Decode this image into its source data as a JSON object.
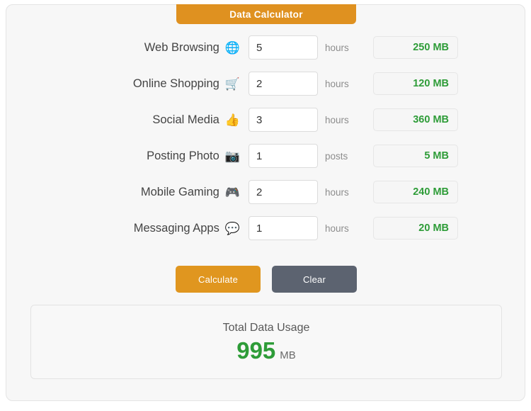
{
  "header": {
    "title": "Data Calculator",
    "accent_color": "#df9120"
  },
  "rows": [
    {
      "label": "Web Browsing",
      "icon": "globe-icon",
      "glyph": "🌐",
      "value": "5",
      "placeholder": "0",
      "unit": "hours",
      "result": "250 MB"
    },
    {
      "label": "Online Shopping",
      "icon": "shopping-cart-icon",
      "glyph": "🛒",
      "value": "2",
      "placeholder": "0",
      "unit": "hours",
      "result": "120 MB"
    },
    {
      "label": "Social Media",
      "icon": "thumbs-up-icon",
      "glyph": "👍",
      "value": "3",
      "placeholder": "0",
      "unit": "hours",
      "result": "360 MB"
    },
    {
      "label": "Posting Photo",
      "icon": "camera-icon",
      "glyph": "📷",
      "value": "1",
      "placeholder": "0",
      "unit": "posts",
      "result": "5 MB"
    },
    {
      "label": "Mobile Gaming",
      "icon": "game-controller-icon",
      "glyph": "🎮",
      "value": "2",
      "placeholder": "0",
      "unit": "hours",
      "result": "240 MB"
    },
    {
      "label": "Messaging Apps",
      "icon": "speech-balloon-icon",
      "glyph": "💬",
      "value": "1",
      "placeholder": "0",
      "unit": "hours",
      "result": "20 MB"
    }
  ],
  "buttons": {
    "calculate_label": "Calculate",
    "calculate_color": "#e0961f",
    "clear_label": "Clear",
    "clear_color": "#5c6370"
  },
  "total": {
    "label": "Total Data Usage",
    "value": "995",
    "unit": "MB",
    "value_color": "#2e9c38"
  },
  "result_color": "#2e9c38"
}
